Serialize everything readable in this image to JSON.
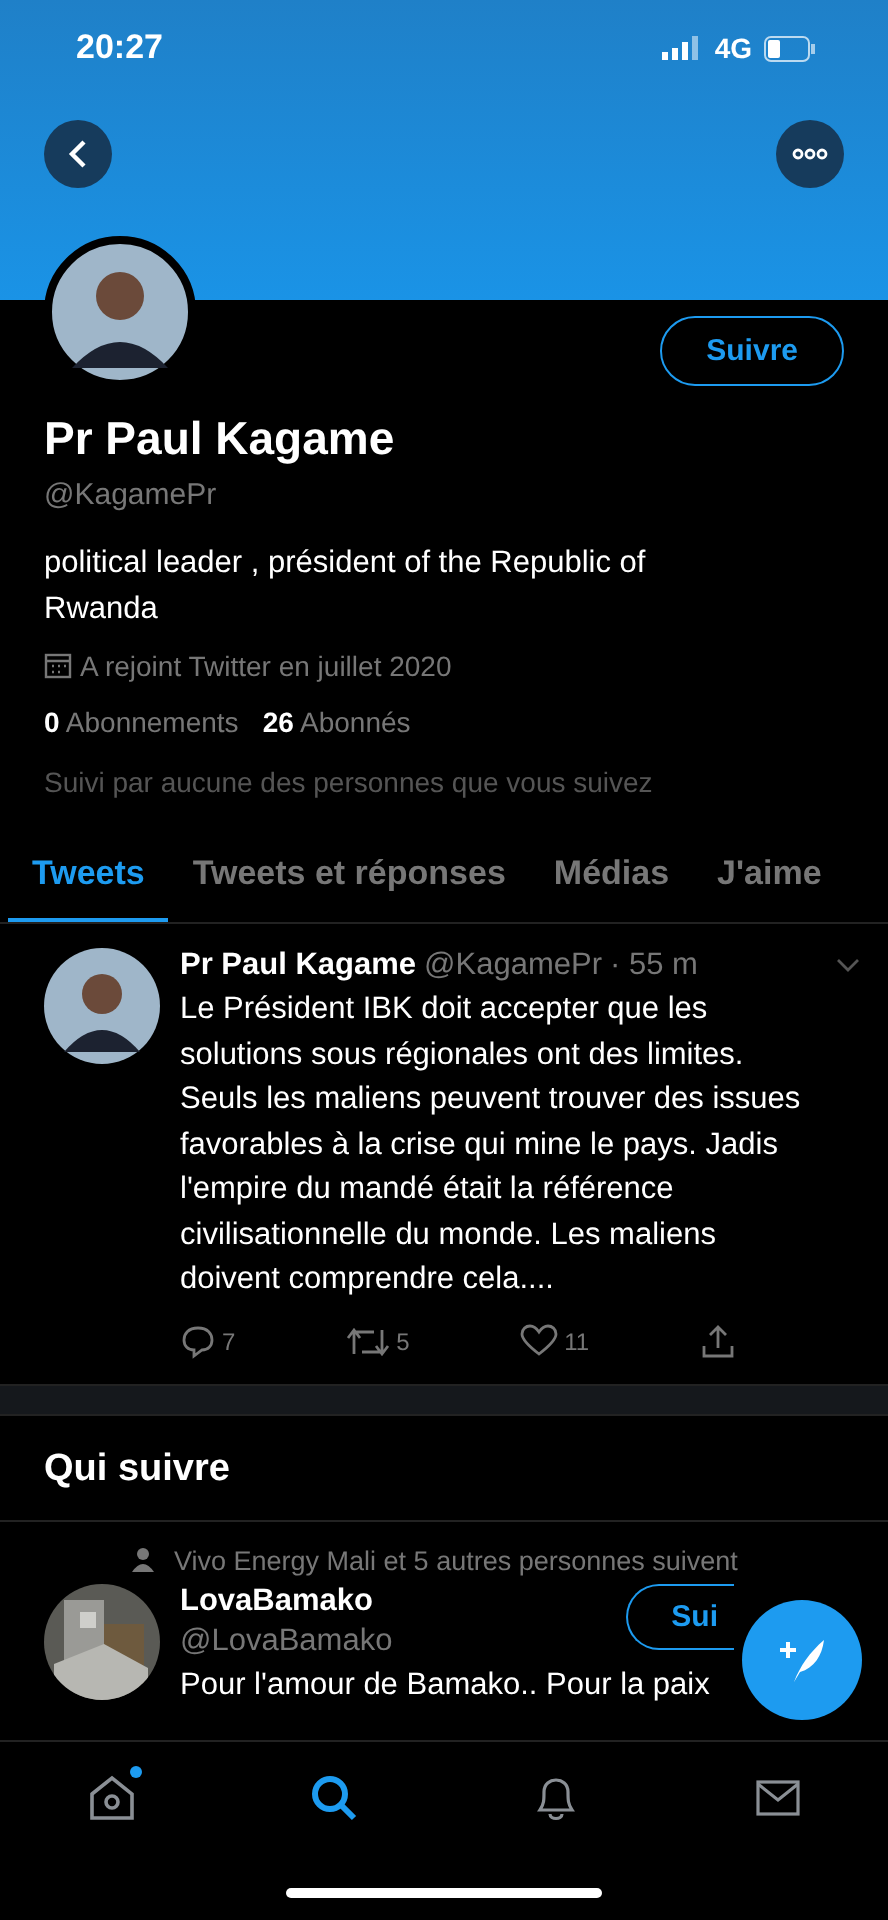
{
  "status_bar": {
    "time": "20:27",
    "network": "4G"
  },
  "profile": {
    "name": "Pr Paul Kagame",
    "handle": "@KagamePr",
    "follow_button": "Suivre",
    "bio": "political leader , président of the Republic of Rwanda",
    "joined": "A rejoint Twitter en juillet 2020",
    "following_count": "0",
    "following_label": "Abonnements",
    "followers_count": "26",
    "followers_label": "Abonnés",
    "followed_by": "Suivi par aucune des personnes que vous suivez"
  },
  "tabs": [
    {
      "label": "Tweets",
      "selected": true
    },
    {
      "label": "Tweets et réponses",
      "selected": false
    },
    {
      "label": "Médias",
      "selected": false
    },
    {
      "label": "J'aime",
      "selected": false
    }
  ],
  "tweet": {
    "author": "Pr Paul Kagame",
    "handle": "@KagamePr",
    "time": "· 55 m",
    "text": "Le Président IBK doit accepter que les solutions sous régionales ont des limites. Seuls les maliens peuvent trouver des issues favorables à la crise qui mine le pays. Jadis l'empire du mandé était la référence civilisationnelle du monde. Les maliens doivent comprendre cela....",
    "replies": "7",
    "retweets": "5",
    "likes": "11"
  },
  "who_to_follow": {
    "title": "Qui suivre",
    "items": [
      {
        "context": "Vivo Energy Mali et 5 autres personnes suivent",
        "name": "LovaBamako",
        "handle": "@LovaBamako",
        "bio": "Pour l'amour de Bamako.. Pour la paix",
        "button": "Sui"
      }
    ]
  },
  "bottom_nav": [
    {
      "kind": "home",
      "selected": false,
      "badge": true
    },
    {
      "kind": "search",
      "selected": true,
      "badge": false
    },
    {
      "kind": "notifications",
      "selected": false,
      "badge": false
    },
    {
      "kind": "messages",
      "selected": false,
      "badge": false
    }
  ]
}
